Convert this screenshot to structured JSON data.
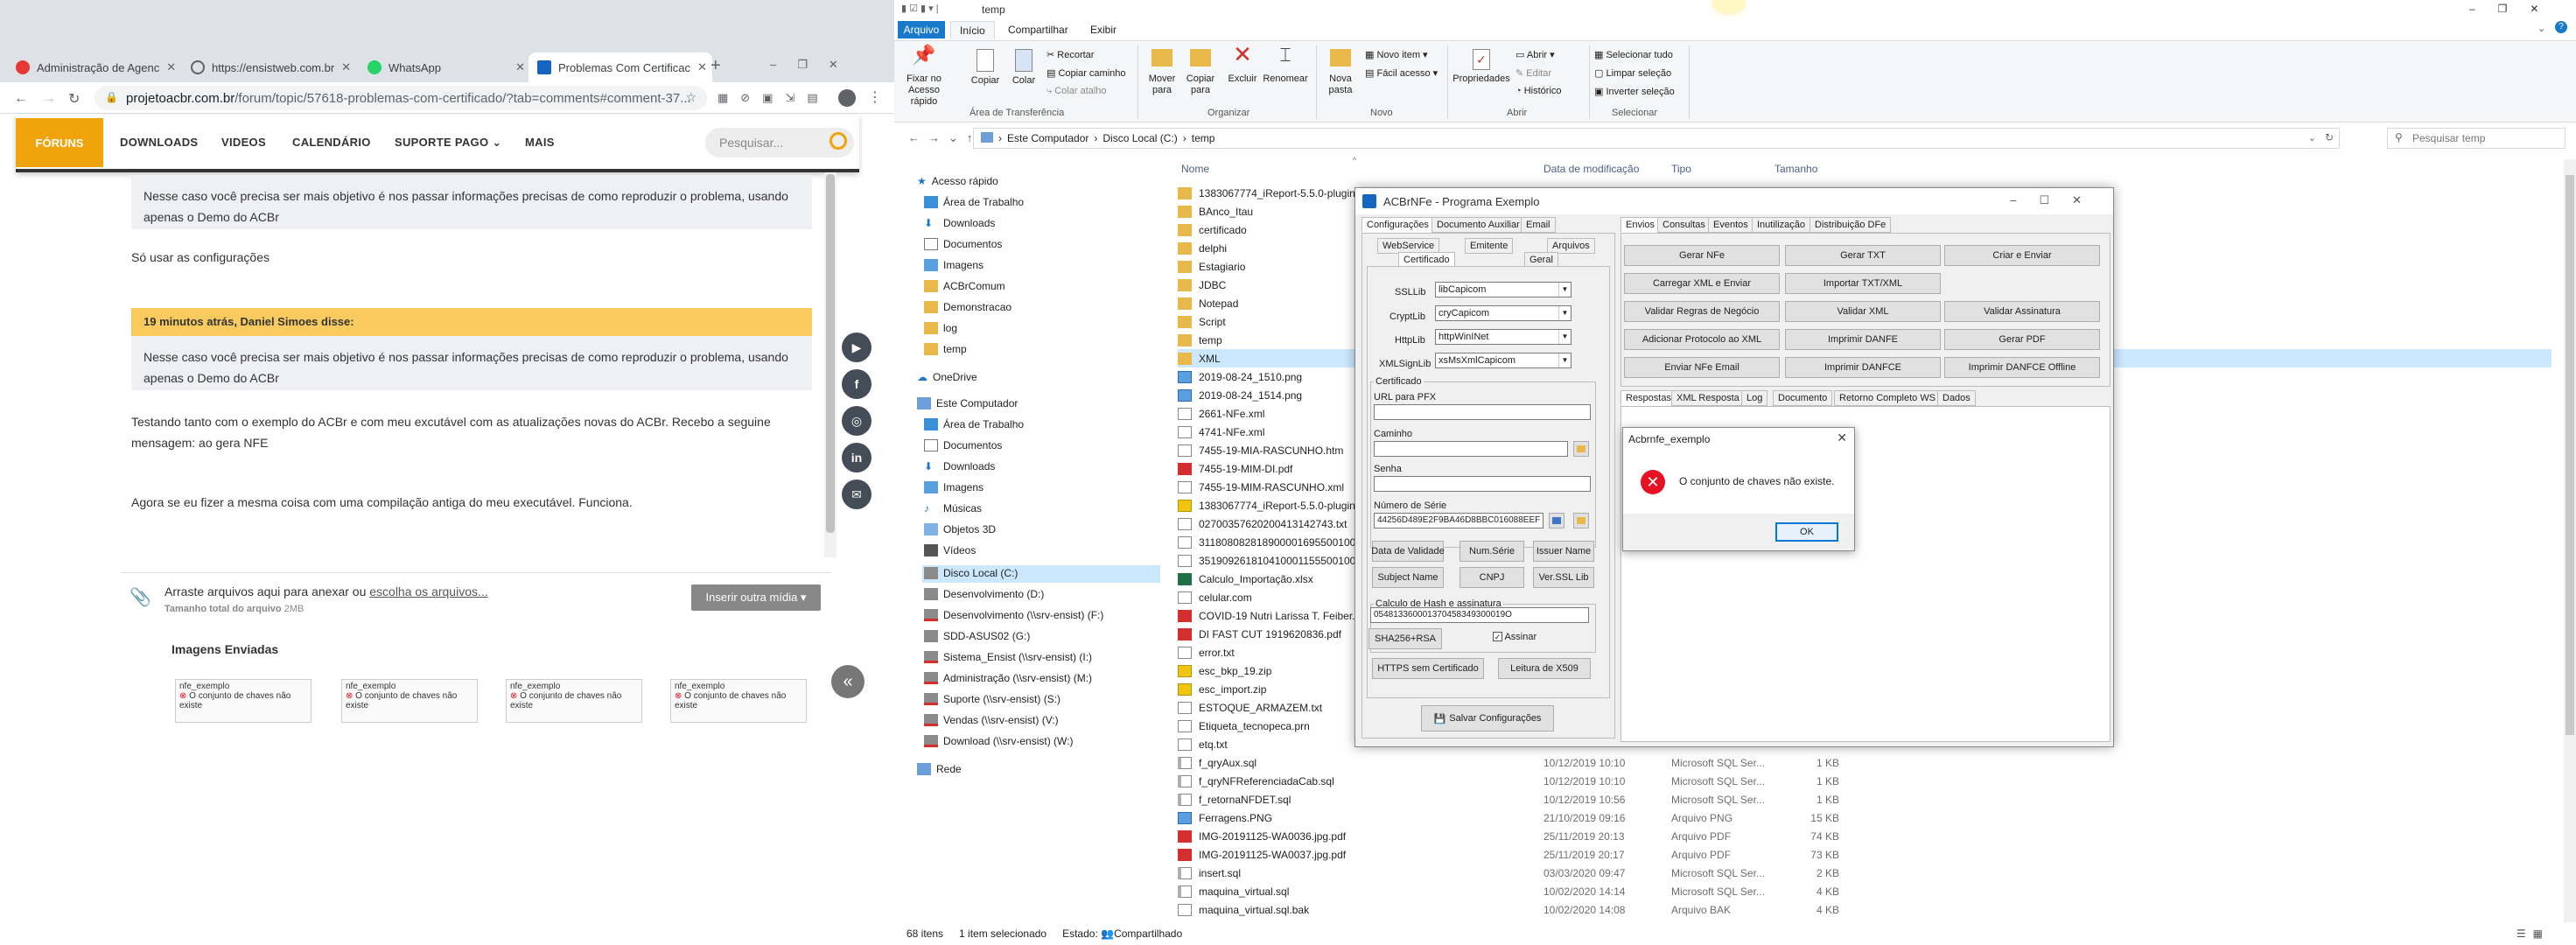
{
  "chrome": {
    "tabs": [
      {
        "label": "Administração de Agenc",
        "fav_color": "#e53935"
      },
      {
        "label": "https://ensistweb.com.br",
        "fav_color": "#5f6368"
      },
      {
        "label": "WhatsApp",
        "fav_color": "#25d366"
      },
      {
        "label": "Problemas Com Certificac",
        "fav_color": "#1565c0"
      }
    ],
    "new_tab": "+",
    "url": "projetoacbr.com.br",
    "url_path": "/forum/topic/57618-problemas-com-certificado/?tab=comments#comment-37..."
  },
  "site": {
    "nav": {
      "forums": "FÓRUNS",
      "downloads": "DOWNLOADS",
      "videos": "VIDEOS",
      "calendar": "CALENDÁRIO",
      "support": "SUPORTE PAGO",
      "more": "MAIS",
      "search_placeholder": "Pesquisar..."
    },
    "quote1": "Nesse caso você precisa ser mais objetivo é nos passar informações precisas de como reproduzir o problema, usando apenas o Demo do ACBr",
    "text1": "Só usar as configurações",
    "quote2_head": "19 minutos atrás, Daniel Simoes disse:",
    "quote2": "Nesse caso você precisa ser mais objetivo é nos passar informações precisas de como reproduzir o problema, usando apenas o Demo do ACBr",
    "text2a": "Testando tanto com o exemplo do ACBr e com meu excutável com as atualizações novas do ACBr. Recebo a seguine",
    "text2b": "mensagem: ao gera NFE",
    "text3": "Agora se eu fizer a mesma coisa com uma compilação antiga do meu executável. Funciona.",
    "drop_text": "Arraste arquivos aqui para anexar ou",
    "drop_link": "escolha os arquivos...",
    "drop_total": "Tamanho total do arquivo",
    "drop_size": "2MB",
    "insert_button": "Inserir outra mídia ▾",
    "images_title": "Imagens Enviadas",
    "thumb_label": "nfe_exemplo",
    "thumb_caption": "O conjunto de chaves não existe",
    "social": [
      "▶",
      "f",
      "◎",
      "in",
      "✉"
    ]
  },
  "explorer": {
    "title": "temp",
    "tabs": {
      "file": "Arquivo",
      "home": "Início",
      "share": "Compartilhar",
      "view": "Exibir"
    },
    "ribbon": {
      "pin": "Fixar no Acesso rápido",
      "copy": "Copiar",
      "paste": "Colar",
      "cut": "Recortar",
      "copy_path": "Copiar caminho",
      "paste_shortcut": "Colar atalho",
      "clipboard": "Área de Transferência",
      "move": "Mover para",
      "copy_to": "Copiar para",
      "delete": "Excluir",
      "rename": "Renomear",
      "organize": "Organizar",
      "new_folder": "Nova pasta",
      "new_item": "Novo item ▾",
      "easy_access": "Fácil acesso ▾",
      "new_group": "Novo",
      "properties": "Propriedades",
      "open": "Abrir ▾",
      "edit": "Editar",
      "history": "Histórico",
      "open_group": "Abrir",
      "select_all": "Selecionar tudo",
      "select_none": "Limpar seleção",
      "invert": "Inverter seleção",
      "select_group": "Selecionar"
    },
    "breadcrumb": [
      "Este Computador",
      "Disco Local (C:)",
      "temp"
    ],
    "search_placeholder": "Pesquisar temp",
    "nav": {
      "quick": "Acesso rápido",
      "desktop": "Área de Trabalho",
      "downloads": "Downloads",
      "documents": "Documentos",
      "images": "Imagens",
      "acbrcomum": "ACBrComum",
      "demo": "Demonstracao",
      "log": "log",
      "temp": "temp",
      "onedrive": "OneDrive",
      "thispc": "Este Computador",
      "desktop2": "Área de Trabalho",
      "documents2": "Documentos",
      "downloads2": "Downloads",
      "images2": "Imagens",
      "music": "Músicas",
      "objects": "Objetos 3D",
      "videos": "Vídeos",
      "c": "Disco Local (C:)",
      "d": "Desenvolvimento (D:)",
      "f": "Desenvolvimento (\\\\srv-ensist) (F:)",
      "g": "SDD-ASUS02 (G:)",
      "i": "Sistema_Ensist (\\\\srv-ensist) (I:)",
      "m": "Administração (\\\\srv-ensist) (M:)",
      "s": "Suporte (\\\\srv-ensist) (S:)",
      "v": "Vendas (\\\\srv-ensist) (V:)",
      "w": "Download (\\\\srv-ensist) (W:)",
      "network": "Rede"
    },
    "columns": {
      "name": "Nome",
      "date": "Data de modificação",
      "type": "Tipo",
      "size": "Tamanho"
    },
    "files": [
      {
        "name": "1383067774_iReport-5.5.0-plugin",
        "date": "",
        "type": "",
        "size": "",
        "icon": "folder"
      },
      {
        "name": "BAnco_Itau",
        "date": "",
        "type": "",
        "size": "",
        "icon": "folder"
      },
      {
        "name": "certificado",
        "date": "",
        "type": "",
        "size": "",
        "icon": "folder"
      },
      {
        "name": "delphi",
        "date": "",
        "type": "",
        "size": "",
        "icon": "folder"
      },
      {
        "name": "Estagiario",
        "date": "",
        "type": "",
        "size": "",
        "icon": "folder"
      },
      {
        "name": "JDBC",
        "date": "",
        "type": "",
        "size": "",
        "icon": "folder"
      },
      {
        "name": "Notepad",
        "date": "",
        "type": "",
        "size": "",
        "icon": "folder"
      },
      {
        "name": "Script",
        "date": "",
        "type": "",
        "size": "",
        "icon": "folder"
      },
      {
        "name": "temp",
        "date": "",
        "type": "",
        "size": "",
        "icon": "folder"
      },
      {
        "name": "XML",
        "date": "",
        "type": "",
        "size": "",
        "icon": "folder",
        "selected": true
      },
      {
        "name": "2019-08-24_1510.png",
        "date": "",
        "type": "",
        "size": "",
        "icon": "image"
      },
      {
        "name": "2019-08-24_1514.png",
        "date": "",
        "type": "",
        "size": "",
        "icon": "image"
      },
      {
        "name": "2661-NFe.xml",
        "date": "",
        "type": "",
        "size": "",
        "icon": "file"
      },
      {
        "name": "4741-NFe.xml",
        "date": "",
        "type": "",
        "size": "",
        "icon": "file"
      },
      {
        "name": "7455-19-MIA-RASCUNHO.htm",
        "date": "",
        "type": "",
        "size": "",
        "icon": "file"
      },
      {
        "name": "7455-19-MIM-DI.pdf",
        "date": "",
        "type": "",
        "size": "",
        "icon": "pdf"
      },
      {
        "name": "7455-19-MIM-RASCUNHO.xml",
        "date": "",
        "type": "",
        "size": "",
        "icon": "file"
      },
      {
        "name": "1383067774_iReport-5.5.0-plugin.zip",
        "date": "",
        "type": "",
        "size": "",
        "icon": "zip"
      },
      {
        "name": "02700357620200413142743.txt",
        "date": "",
        "type": "",
        "size": "",
        "icon": "file"
      },
      {
        "name": "31180808281890000169550010000",
        "date": "",
        "type": "",
        "size": "",
        "icon": "file"
      },
      {
        "name": "35190926181041000115550010000",
        "date": "",
        "type": "",
        "size": "",
        "icon": "file"
      },
      {
        "name": "Calculo_Importação.xlsx",
        "date": "",
        "type": "",
        "size": "",
        "icon": "xls"
      },
      {
        "name": "celular.com",
        "date": "",
        "type": "",
        "size": "",
        "icon": "file"
      },
      {
        "name": "COVID-19 Nutri Larissa T. Feiber.pd",
        "date": "",
        "type": "",
        "size": "",
        "icon": "pdf"
      },
      {
        "name": "DI FAST CUT 1919620836.pdf",
        "date": "",
        "type": "",
        "size": "",
        "icon": "pdf"
      },
      {
        "name": "error.txt",
        "date": "",
        "type": "",
        "size": "",
        "icon": "file"
      },
      {
        "name": "esc_bkp_19.zip",
        "date": "",
        "type": "",
        "size": "",
        "icon": "zip"
      },
      {
        "name": "esc_import.zip",
        "date": "",
        "type": "",
        "size": "",
        "icon": "zip"
      },
      {
        "name": "ESTOQUE_ARMAZEM.txt",
        "date": "",
        "type": "",
        "size": "",
        "icon": "file"
      },
      {
        "name": "Etiqueta_tecnopeca.prn",
        "date": "",
        "type": "",
        "size": "",
        "icon": "file"
      },
      {
        "name": "etq.txt",
        "date": "",
        "type": "",
        "size": "",
        "icon": "file"
      },
      {
        "name": "f_qryAux.sql",
        "date": "10/12/2019 10:10",
        "type": "Microsoft SQL Ser...",
        "size": "1 KB",
        "icon": "sql"
      },
      {
        "name": "f_qryNFReferenciadaCab.sql",
        "date": "10/12/2019 10:10",
        "type": "Microsoft SQL Ser...",
        "size": "1 KB",
        "icon": "sql"
      },
      {
        "name": "f_retornaNFDET.sql",
        "date": "10/12/2019 10:56",
        "type": "Microsoft SQL Ser...",
        "size": "1 KB",
        "icon": "sql"
      },
      {
        "name": "Ferragens.PNG",
        "date": "21/10/2019 09:16",
        "type": "Arquivo PNG",
        "size": "15 KB",
        "icon": "image"
      },
      {
        "name": "IMG-20191125-WA0036.jpg.pdf",
        "date": "25/11/2019 20:13",
        "type": "Arquivo PDF",
        "size": "74 KB",
        "icon": "pdf"
      },
      {
        "name": "IMG-20191125-WA0037.jpg.pdf",
        "date": "25/11/2019 20:17",
        "type": "Arquivo PDF",
        "size": "73 KB",
        "icon": "pdf"
      },
      {
        "name": "insert.sql",
        "date": "03/03/2020 09:47",
        "type": "Microsoft SQL Ser...",
        "size": "2 KB",
        "icon": "sql"
      },
      {
        "name": "maquina_virtual.sql",
        "date": "10/02/2020 14:14",
        "type": "Microsoft SQL Ser...",
        "size": "4 KB",
        "icon": "sql"
      },
      {
        "name": "maquina_virtual.sql.bak",
        "date": "10/02/2020 14:08",
        "type": "Arquivo BAK",
        "size": "4 KB",
        "icon": "file"
      }
    ],
    "status": {
      "items": "68 itens",
      "selected": "1 item selecionado",
      "state_label": "Estado:",
      "state": "Compartilhado"
    }
  },
  "acbr": {
    "title": "ACBrNFe - Programa Exemplo",
    "left_tabs": [
      "Configurações",
      "Documento Auxiliar",
      "Email"
    ],
    "sub_tabs_row1": [
      "WebService",
      "Emitente",
      "Arquivos"
    ],
    "sub_tabs_row2": [
      "Certificado",
      "Geral"
    ],
    "ssllib_label": "SSLLib",
    "ssllib": "libCapicom",
    "cryptlib_label": "CryptLib",
    "cryptlib": "cryCapicom",
    "httplib_label": "HttpLib",
    "httplib": "httpWinINet",
    "xmlsignlib_label": "XMLSignLib",
    "xmlsignlib": "xsMsXmlCapicom",
    "cert_group": "Certificado",
    "pfx_label": "URL para PFX",
    "path_label": "Caminho",
    "password_label": "Senha",
    "serial_label": "Número de Série",
    "serial": "44256D489E2F9BA46D8BBC016088EEF",
    "btn_validity": "Data de Validade",
    "btn_numserie": "Num.Série",
    "btn_issuer": "Issuer Name",
    "btn_subject": "Subject Name",
    "btn_cnpj": "CNPJ",
    "btn_ssl": "Ver.SSL Lib",
    "hash_group": "Calculo de Hash e assinatura",
    "hash_value": "054813360001370458349300019O",
    "btn_sha": "SHA256+RSA",
    "sign_label": "Assinar",
    "btn_https": "HTTPS sem Certificado",
    "btn_x509": "Leitura de X509",
    "save_button": "Salvar Configurações",
    "right_tabs": [
      "Envios",
      "Consultas",
      "Eventos",
      "Inutilização",
      "Distribuição DFe"
    ],
    "buttons": [
      "Gerar NFe",
      "Gerar TXT",
      "Criar e Enviar",
      "Carregar XML e Enviar",
      "Importar TXT/XML",
      "",
      "Validar Regras de Negócio",
      "Validar XML",
      "Validar Assinatura",
      "Adicionar Protocolo ao XML",
      "Imprimir DANFE",
      "Gerar PDF",
      "Enviar NFe Email",
      "Imprimir DANFCE",
      "Imprimir DANFCE Offline"
    ],
    "bottom_tabs": [
      "Respostas",
      "XML Resposta",
      "Log",
      "Documento",
      "Retorno Completo WS",
      "Dados"
    ]
  },
  "dialog": {
    "title": "Acbrnfe_exemplo",
    "message": "O conjunto de chaves não existe.",
    "ok": "OK"
  },
  "colors": {
    "accent": "#f0a30a",
    "explorer_blue": "#1979ca",
    "error_red": "#e81123"
  }
}
